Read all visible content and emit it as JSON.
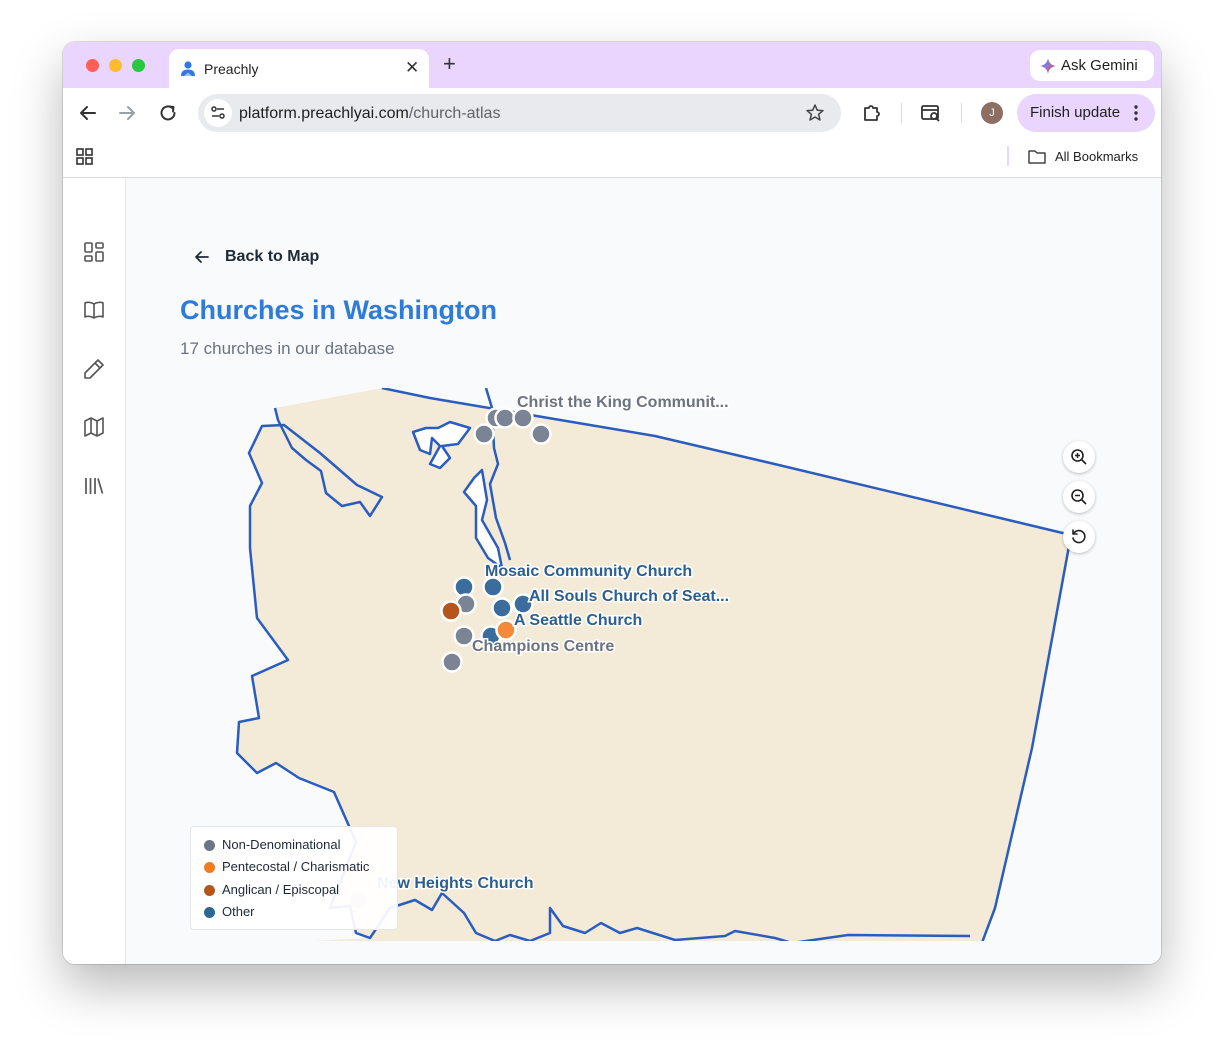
{
  "browser": {
    "tab_title": "Preachly",
    "url_host": "platform.preachlyai.com",
    "url_path": "/church-atlas",
    "ask_gemini_label": "Ask Gemini",
    "finish_update_label": "Finish update",
    "profile_initial": "J",
    "bookmarks_label": "All Bookmarks"
  },
  "sidebar": {
    "icons": [
      "dashboard-icon",
      "book-icon",
      "pencil-icon",
      "map-icon",
      "library-icon"
    ]
  },
  "page": {
    "back_label": "Back to Map",
    "title": "Churches in Washington",
    "subtitle": "17 churches in our database"
  },
  "colors": {
    "accent": "#2f7bd9",
    "non_denominational": "#7b8495",
    "pentecostal": "#f28a3a",
    "anglican": "#b5551c",
    "other": "#3a6d9b",
    "land": "#f3ead8",
    "border": "#2a5dbf"
  },
  "map": {
    "labels": {
      "christ_the_king": "Christ the King Communit...",
      "mosaic": "Mosaic Community Church",
      "all_souls": "All Souls Church of Seat...",
      "seattle": "A Seattle Church",
      "champions": "Champions Centre",
      "new_heights": "New Heights Church"
    },
    "zoom_controls": [
      "zoom-in-icon",
      "zoom-out-icon",
      "reset-icon"
    ]
  },
  "legend": [
    {
      "label": "Non-Denominational",
      "color": "#6b7587"
    },
    {
      "label": "Pentecostal / Charismatic",
      "color": "#f07b22"
    },
    {
      "label": "Anglican / Episcopal",
      "color": "#b5551c"
    },
    {
      "label": "Other",
      "color": "#2b6791"
    }
  ]
}
